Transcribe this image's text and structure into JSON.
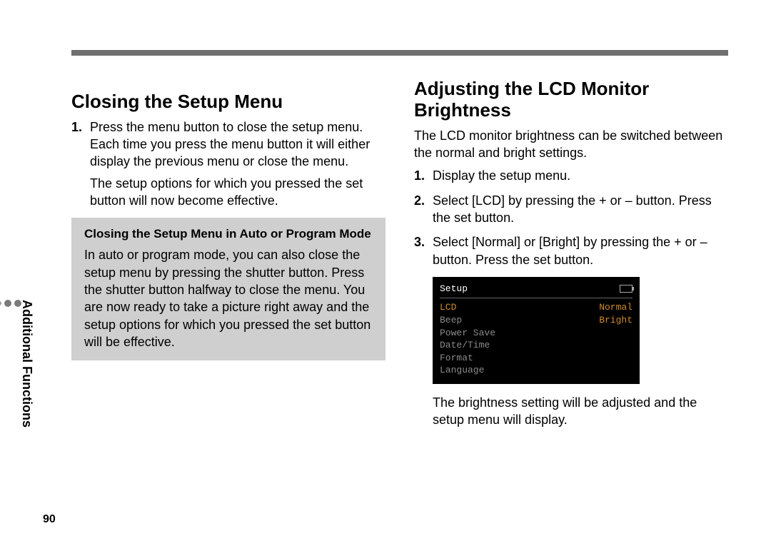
{
  "meta": {
    "section_label": "Additional Functions",
    "page_number": "90"
  },
  "left": {
    "heading": "Closing the Setup Menu",
    "step1_num": "1.",
    "step1_text": "Press the menu button to close the setup menu. Each time you press the menu button it will either display the previous menu or close the menu.",
    "step1_note": "The setup options for which you pressed the set button will now become effective.",
    "tip_title": "Closing the Setup Menu in Auto or Program Mode",
    "tip_body": "In auto or program mode, you can also close the setup menu by pressing the shutter button. Press the shutter button halfway to close the menu. You are now ready to take a picture right away and the setup options for which you pressed the set button will be effective."
  },
  "right": {
    "heading": "Adjusting the LCD Monitor Brightness",
    "intro": "The LCD monitor brightness can be switched between the normal and bright settings.",
    "step1_num": "1.",
    "step1_text": "Display the setup menu.",
    "step2_num": "2.",
    "step2_text": "Select [LCD] by pressing the + or – button. Press the set button.",
    "step3_num": "3.",
    "step3_text": "Select [Normal] or [Bright] by pressing the + or – button. Press the set button.",
    "after_lcd": "The brightness setting will be adjusted and the setup menu will display."
  },
  "lcd": {
    "title": "Setup",
    "rows": [
      {
        "label": "LCD",
        "value": "Normal",
        "label_hl": true,
        "value_hl": true
      },
      {
        "label": "Beep",
        "value": "Bright",
        "label_hl": false,
        "value_hl": true
      },
      {
        "label": "Power Save",
        "value": "",
        "label_hl": false,
        "value_hl": false
      },
      {
        "label": "Date/Time",
        "value": "",
        "label_hl": false,
        "value_hl": false
      },
      {
        "label": "Format",
        "value": "",
        "label_hl": false,
        "value_hl": false
      },
      {
        "label": "Language",
        "value": "",
        "label_hl": false,
        "value_hl": false
      }
    ]
  }
}
